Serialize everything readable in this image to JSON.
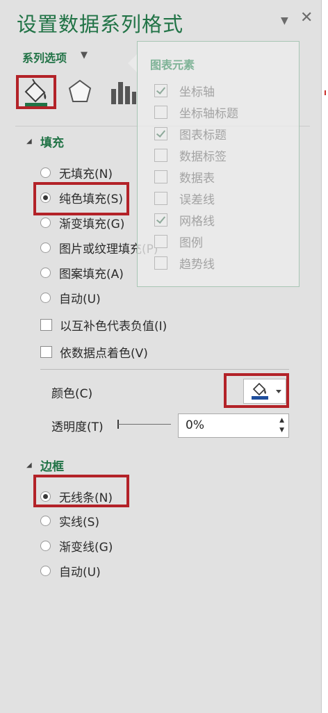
{
  "pane": {
    "title": "设置数据系列格式",
    "options_label": "系列选项",
    "tabs": [
      "fill-line-icon",
      "effects-pentagon-icon",
      "series-options-bar-icon"
    ],
    "fill_section": {
      "heading": "填充",
      "radio_options": [
        {
          "label": "无填充(N)",
          "checked": false
        },
        {
          "label": "纯色填充(S)",
          "checked": true
        },
        {
          "label": "渐变填充(G)",
          "checked": false
        },
        {
          "label": "图片或纹理填充(P)",
          "checked": false
        },
        {
          "label": "图案填充(A)",
          "checked": false
        },
        {
          "label": "自动(U)",
          "checked": false
        }
      ],
      "checkboxes": [
        {
          "label": "以互补色代表负值(I)",
          "checked": false
        },
        {
          "label": "依数据点着色(V)",
          "checked": false
        }
      ],
      "color_label": "颜色(C)",
      "transparency_label": "透明度(T)",
      "transparency_value": "0%"
    },
    "border_section": {
      "heading": "边框",
      "radio_options": [
        {
          "label": "无线条(N)",
          "checked": true
        },
        {
          "label": "实线(S)",
          "checked": false
        },
        {
          "label": "渐变线(G)",
          "checked": false
        },
        {
          "label": "自动(U)",
          "checked": false
        }
      ]
    }
  },
  "chart_elements_popup": {
    "title": "图表元素",
    "items": [
      {
        "label": "坐标轴",
        "checked": true
      },
      {
        "label": "坐标轴标题",
        "checked": false
      },
      {
        "label": "图表标题",
        "checked": true
      },
      {
        "label": "数据标签",
        "checked": false
      },
      {
        "label": "数据表",
        "checked": false
      },
      {
        "label": "误差线",
        "checked": false
      },
      {
        "label": "网格线",
        "checked": true
      },
      {
        "label": "图例",
        "checked": false
      },
      {
        "label": "趋势线",
        "checked": false
      }
    ]
  },
  "colors": {
    "accent_green": "#217346",
    "highlight_red": "#b32228",
    "fill_color_bar": "#1f4e9c"
  }
}
